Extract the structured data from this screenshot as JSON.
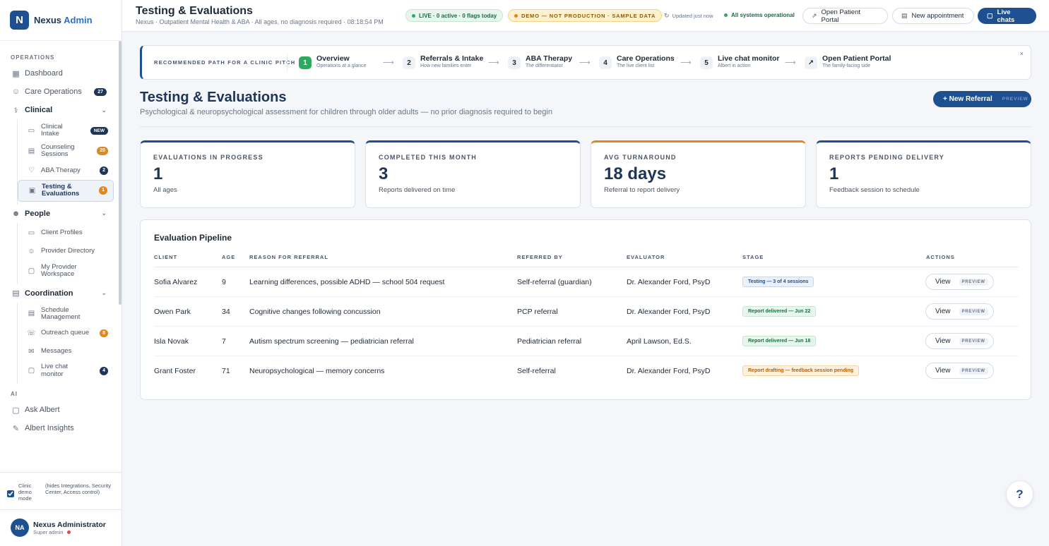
{
  "brand": {
    "logo_letter": "N",
    "name": "Nexus",
    "accent": "Admin"
  },
  "sidebar": {
    "operations_label": "OPERATIONS",
    "dashboard": "Dashboard",
    "care_operations": "Care Operations",
    "care_operations_count": "27",
    "clinical": "Clinical",
    "clinical_items": [
      {
        "label": "Clinical Intake",
        "badge": "NEW"
      },
      {
        "label": "Counseling Sessions",
        "badge": "20"
      },
      {
        "label": "ABA Therapy",
        "badge": "2"
      },
      {
        "label": "Testing & Evaluations",
        "badge": "1"
      }
    ],
    "people": "People",
    "people_items": [
      {
        "label": "Client Profiles"
      },
      {
        "label": "Provider Directory"
      },
      {
        "label": "My Provider Workspace"
      }
    ],
    "coordination": "Coordination",
    "coordination_items": [
      {
        "label": "Schedule Management"
      },
      {
        "label": "Outreach queue",
        "badge": "8"
      },
      {
        "label": "Messages"
      },
      {
        "label": "Live chat monitor",
        "badge": "4"
      }
    ],
    "ai_label": "AI",
    "ask_albert": "Ask Albert",
    "albert_insights": "Albert Insights",
    "demo_mode_label": "Clinic demo mode",
    "demo_mode_desc": "(hides Integrations, Security Center, Access control)",
    "user_initials": "NA",
    "user_name": "Nexus Administrator",
    "user_role": "Super admin"
  },
  "header": {
    "title": "Testing & Evaluations",
    "subtitle": "Nexus · Outpatient Mental Health & ABA · All ages, no diagnosis required · 08:18:54 PM",
    "live_pill": "LIVE · 0 active · 0 flags today",
    "demo_pill": "DEMO — NOT PRODUCTION · SAMPLE DATA",
    "updated": "Updated",
    "updated_when": "just now",
    "system_status": "All systems operational",
    "open_portal": "Open Patient Portal",
    "new_appointment": "New appointment",
    "live_chats": "Live chats"
  },
  "path": {
    "label": "RECOMMENDED PATH FOR A CLINIC PITCH",
    "steps": [
      {
        "num": "1",
        "title": "Overview",
        "desc": "Operations at a glance"
      },
      {
        "num": "2",
        "title": "Referrals & Intake",
        "desc": "How new families enter"
      },
      {
        "num": "3",
        "title": "ABA Therapy",
        "desc": "The differentiator"
      },
      {
        "num": "4",
        "title": "Care Operations",
        "desc": "The live client list"
      },
      {
        "num": "5",
        "title": "Live chat monitor",
        "desc": "Albert in action"
      },
      {
        "num": "↗",
        "title": "Open Patient Portal",
        "desc": "The family-facing side"
      }
    ],
    "close": "×"
  },
  "main": {
    "title": "Testing & Evaluations",
    "subtitle": "Psychological & neuropsychological assessment for children through older adults — no prior diagnosis required to begin",
    "new_referral": "+ New Referral",
    "preview": "PREVIEW"
  },
  "kpis": [
    {
      "label": "EVALUATIONS IN PROGRESS",
      "value": "1",
      "note": "All ages"
    },
    {
      "label": "COMPLETED THIS MONTH",
      "value": "3",
      "note": "Reports delivered on time"
    },
    {
      "label": "AVG TURNAROUND",
      "value": "18 days",
      "note": "Referral to report delivery"
    },
    {
      "label": "REPORTS PENDING DELIVERY",
      "value": "1",
      "note": "Feedback session to schedule"
    }
  ],
  "pipeline": {
    "title": "Evaluation Pipeline",
    "columns": [
      "CLIENT",
      "AGE",
      "REASON FOR REFERRAL",
      "REFERRED BY",
      "EVALUATOR",
      "STAGE",
      "ACTIONS"
    ],
    "rows": [
      {
        "client": "Sofia Alvarez",
        "age": "9",
        "reason": "Learning differences, possible ADHD — school 504 request",
        "referred_by": "Self-referral (guardian)",
        "evaluator": "Dr. Alexander Ford, PsyD",
        "stage": "Testing — 3 of 4 sessions"
      },
      {
        "client": "Owen Park",
        "age": "34",
        "reason": "Cognitive changes following concussion",
        "referred_by": "PCP referral",
        "evaluator": "Dr. Alexander Ford, PsyD",
        "stage": "Report delivered — Jun 22"
      },
      {
        "client": "Isla Novak",
        "age": "7",
        "reason": "Autism spectrum screening — pediatrician referral",
        "referred_by": "Pediatrician referral",
        "evaluator": "April Lawson, Ed.S.",
        "stage": "Report delivered — Jun 18"
      },
      {
        "client": "Grant Foster",
        "age": "71",
        "reason": "Neuropsychological — memory concerns",
        "referred_by": "Self-referral",
        "evaluator": "Dr. Alexander Ford, PsyD",
        "stage": "Report drafting — feedback session pending"
      }
    ],
    "view_label": "View",
    "preview_label": "PREVIEW"
  },
  "help": "?"
}
